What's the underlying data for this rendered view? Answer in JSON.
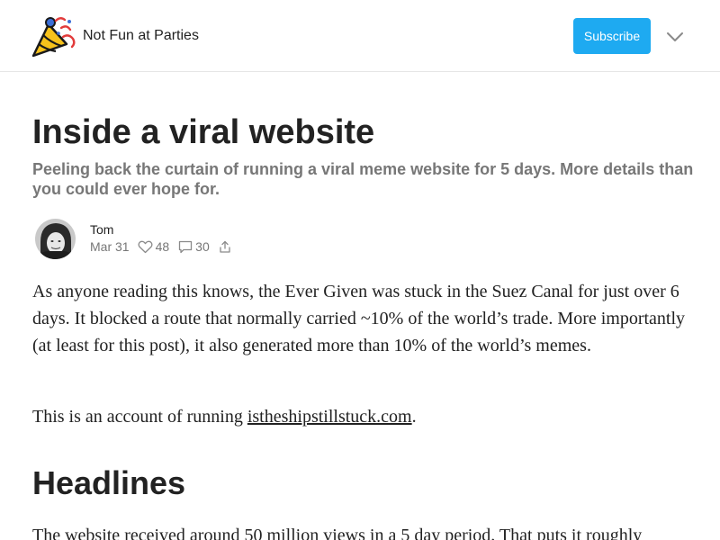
{
  "header": {
    "publication_name": "Not Fun at Parties",
    "subscribe_label": "Subscribe",
    "logo_icon": "party-hat-icon",
    "menu_icon": "chevron-down-icon"
  },
  "post": {
    "title": "Inside a viral website",
    "subtitle": "Peeling back the curtain of running a viral meme website for 5 days. More details than you could ever hope for.",
    "author": "Tom",
    "date": "Mar 31",
    "likes": "48",
    "comments": "30",
    "icons": {
      "like": "heart-icon",
      "comments": "comment-icon",
      "share": "share-icon"
    }
  },
  "body": {
    "paragraph1": "As anyone reading this knows, the Ever Given was stuck in the Suez Canal for just over 6 days. It blocked a route that normally carried ~10% of the world’s trade. More importantly (at least for this post), it also generated more than 10% of the world’s memes.",
    "paragraph2_prefix": "This is an account of running ",
    "paragraph2_link": "istheshipstillstuck.com",
    "paragraph2_suffix": ".",
    "heading1": "Headlines",
    "paragraph3": "The website received around 50 million views in a 5 day period. That puts it roughly"
  },
  "colors": {
    "accent": "#1eaaf1",
    "muted_text": "#777777",
    "text": "#222222",
    "divider": "#e6e6e6"
  }
}
